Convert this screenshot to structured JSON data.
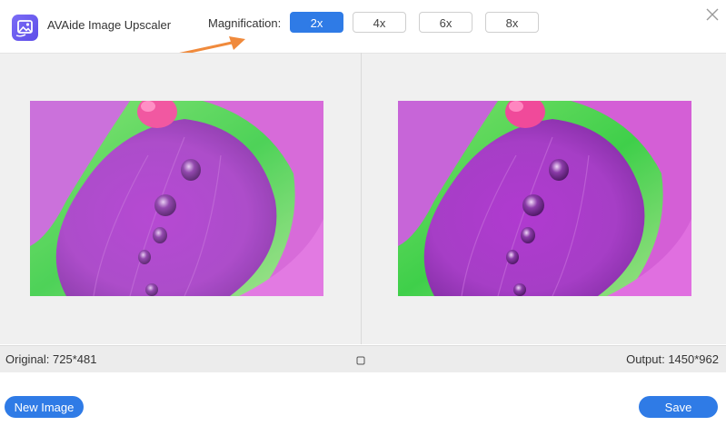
{
  "app": {
    "title": "AVAide Image Upscaler",
    "logo_icon": "image-upscaler-logo-icon",
    "accent_color": "#2f7be6"
  },
  "magnification": {
    "label": "Magnification:",
    "options": [
      {
        "label": "2x",
        "selected": true
      },
      {
        "label": "4x",
        "selected": false
      },
      {
        "label": "6x",
        "selected": false
      },
      {
        "label": "8x",
        "selected": false
      }
    ]
  },
  "window": {
    "close_icon": "close-icon"
  },
  "annotation": {
    "icon": "orange-arrow-icon",
    "color": "#f08a3c"
  },
  "preview": {
    "original_image": "flower-petal-water-drops",
    "output_image": "flower-petal-water-drops"
  },
  "info": {
    "original": "Original: 725*481",
    "output": "Output: 1450*962",
    "compare_icon": "compare-square-icon"
  },
  "footer": {
    "new_image_label": "New Image",
    "save_label": "Save"
  }
}
